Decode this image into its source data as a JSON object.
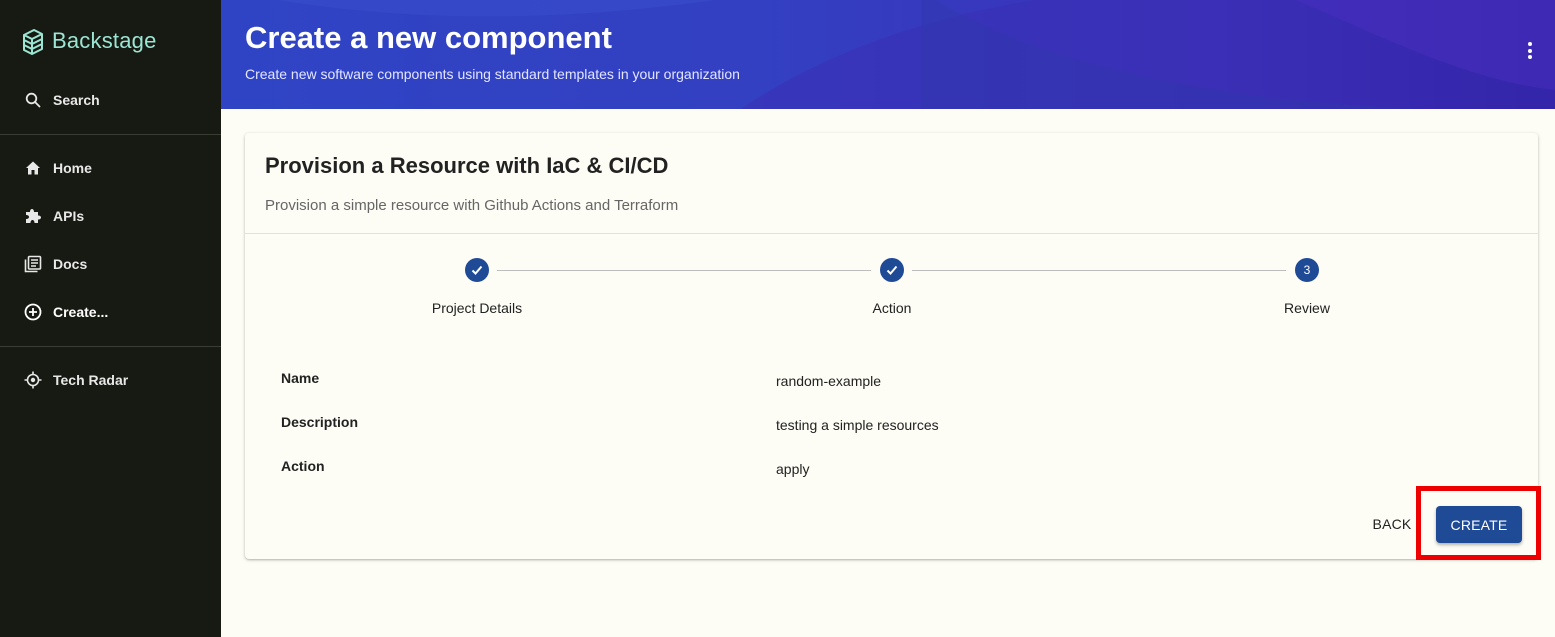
{
  "sidebar": {
    "app_name": "Backstage",
    "search_label": "Search",
    "items": [
      {
        "label": "Home",
        "icon": "home-icon"
      },
      {
        "label": "APIs",
        "icon": "puzzle-icon"
      },
      {
        "label": "Docs",
        "icon": "docs-icon"
      },
      {
        "label": "Create...",
        "icon": "add-circle-icon",
        "active": true
      }
    ],
    "plugins": [
      {
        "label": "Tech Radar",
        "icon": "radar-icon"
      }
    ]
  },
  "header": {
    "title": "Create a new component",
    "subtitle": "Create new software components using standard templates in your organization"
  },
  "template": {
    "title": "Provision a Resource with IaC & CI/CD",
    "description": "Provision a simple resource with Github Actions and Terraform"
  },
  "stepper": {
    "steps": [
      {
        "label": "Project Details",
        "status": "completed"
      },
      {
        "label": "Action",
        "status": "completed"
      },
      {
        "label": "Review",
        "status": "active",
        "number": "3"
      }
    ]
  },
  "review": {
    "rows": [
      {
        "label": "Name",
        "value": "random-example"
      },
      {
        "label": "Description",
        "value": "testing a simple resources"
      },
      {
        "label": "Action",
        "value": "apply"
      }
    ]
  },
  "actions": {
    "back_label": "BACK",
    "create_label": "CREATE"
  },
  "colors": {
    "sidebar_bg": "#171a12",
    "accent": "#1f4a96",
    "logo": "#9be5d3",
    "highlight": "#ee0000"
  }
}
